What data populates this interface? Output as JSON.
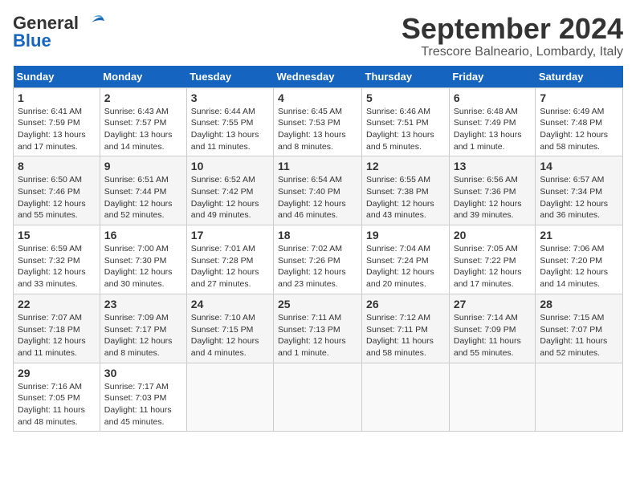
{
  "header": {
    "logo_general": "General",
    "logo_blue": "Blue",
    "month_year": "September 2024",
    "location": "Trescore Balneario, Lombardy, Italy"
  },
  "weekdays": [
    "Sunday",
    "Monday",
    "Tuesday",
    "Wednesday",
    "Thursday",
    "Friday",
    "Saturday"
  ],
  "weeks": [
    [
      {
        "day": "1",
        "info": "Sunrise: 6:41 AM\nSunset: 7:59 PM\nDaylight: 13 hours\nand 17 minutes."
      },
      {
        "day": "2",
        "info": "Sunrise: 6:43 AM\nSunset: 7:57 PM\nDaylight: 13 hours\nand 14 minutes."
      },
      {
        "day": "3",
        "info": "Sunrise: 6:44 AM\nSunset: 7:55 PM\nDaylight: 13 hours\nand 11 minutes."
      },
      {
        "day": "4",
        "info": "Sunrise: 6:45 AM\nSunset: 7:53 PM\nDaylight: 13 hours\nand 8 minutes."
      },
      {
        "day": "5",
        "info": "Sunrise: 6:46 AM\nSunset: 7:51 PM\nDaylight: 13 hours\nand 5 minutes."
      },
      {
        "day": "6",
        "info": "Sunrise: 6:48 AM\nSunset: 7:49 PM\nDaylight: 13 hours\nand 1 minute."
      },
      {
        "day": "7",
        "info": "Sunrise: 6:49 AM\nSunset: 7:48 PM\nDaylight: 12 hours\nand 58 minutes."
      }
    ],
    [
      {
        "day": "8",
        "info": "Sunrise: 6:50 AM\nSunset: 7:46 PM\nDaylight: 12 hours\nand 55 minutes."
      },
      {
        "day": "9",
        "info": "Sunrise: 6:51 AM\nSunset: 7:44 PM\nDaylight: 12 hours\nand 52 minutes."
      },
      {
        "day": "10",
        "info": "Sunrise: 6:52 AM\nSunset: 7:42 PM\nDaylight: 12 hours\nand 49 minutes."
      },
      {
        "day": "11",
        "info": "Sunrise: 6:54 AM\nSunset: 7:40 PM\nDaylight: 12 hours\nand 46 minutes."
      },
      {
        "day": "12",
        "info": "Sunrise: 6:55 AM\nSunset: 7:38 PM\nDaylight: 12 hours\nand 43 minutes."
      },
      {
        "day": "13",
        "info": "Sunrise: 6:56 AM\nSunset: 7:36 PM\nDaylight: 12 hours\nand 39 minutes."
      },
      {
        "day": "14",
        "info": "Sunrise: 6:57 AM\nSunset: 7:34 PM\nDaylight: 12 hours\nand 36 minutes."
      }
    ],
    [
      {
        "day": "15",
        "info": "Sunrise: 6:59 AM\nSunset: 7:32 PM\nDaylight: 12 hours\nand 33 minutes."
      },
      {
        "day": "16",
        "info": "Sunrise: 7:00 AM\nSunset: 7:30 PM\nDaylight: 12 hours\nand 30 minutes."
      },
      {
        "day": "17",
        "info": "Sunrise: 7:01 AM\nSunset: 7:28 PM\nDaylight: 12 hours\nand 27 minutes."
      },
      {
        "day": "18",
        "info": "Sunrise: 7:02 AM\nSunset: 7:26 PM\nDaylight: 12 hours\nand 23 minutes."
      },
      {
        "day": "19",
        "info": "Sunrise: 7:04 AM\nSunset: 7:24 PM\nDaylight: 12 hours\nand 20 minutes."
      },
      {
        "day": "20",
        "info": "Sunrise: 7:05 AM\nSunset: 7:22 PM\nDaylight: 12 hours\nand 17 minutes."
      },
      {
        "day": "21",
        "info": "Sunrise: 7:06 AM\nSunset: 7:20 PM\nDaylight: 12 hours\nand 14 minutes."
      }
    ],
    [
      {
        "day": "22",
        "info": "Sunrise: 7:07 AM\nSunset: 7:18 PM\nDaylight: 12 hours\nand 11 minutes."
      },
      {
        "day": "23",
        "info": "Sunrise: 7:09 AM\nSunset: 7:17 PM\nDaylight: 12 hours\nand 8 minutes."
      },
      {
        "day": "24",
        "info": "Sunrise: 7:10 AM\nSunset: 7:15 PM\nDaylight: 12 hours\nand 4 minutes."
      },
      {
        "day": "25",
        "info": "Sunrise: 7:11 AM\nSunset: 7:13 PM\nDaylight: 12 hours\nand 1 minute."
      },
      {
        "day": "26",
        "info": "Sunrise: 7:12 AM\nSunset: 7:11 PM\nDaylight: 11 hours\nand 58 minutes."
      },
      {
        "day": "27",
        "info": "Sunrise: 7:14 AM\nSunset: 7:09 PM\nDaylight: 11 hours\nand 55 minutes."
      },
      {
        "day": "28",
        "info": "Sunrise: 7:15 AM\nSunset: 7:07 PM\nDaylight: 11 hours\nand 52 minutes."
      }
    ],
    [
      {
        "day": "29",
        "info": "Sunrise: 7:16 AM\nSunset: 7:05 PM\nDaylight: 11 hours\nand 48 minutes."
      },
      {
        "day": "30",
        "info": "Sunrise: 7:17 AM\nSunset: 7:03 PM\nDaylight: 11 hours\nand 45 minutes."
      },
      {
        "day": "",
        "info": ""
      },
      {
        "day": "",
        "info": ""
      },
      {
        "day": "",
        "info": ""
      },
      {
        "day": "",
        "info": ""
      },
      {
        "day": "",
        "info": ""
      }
    ]
  ]
}
